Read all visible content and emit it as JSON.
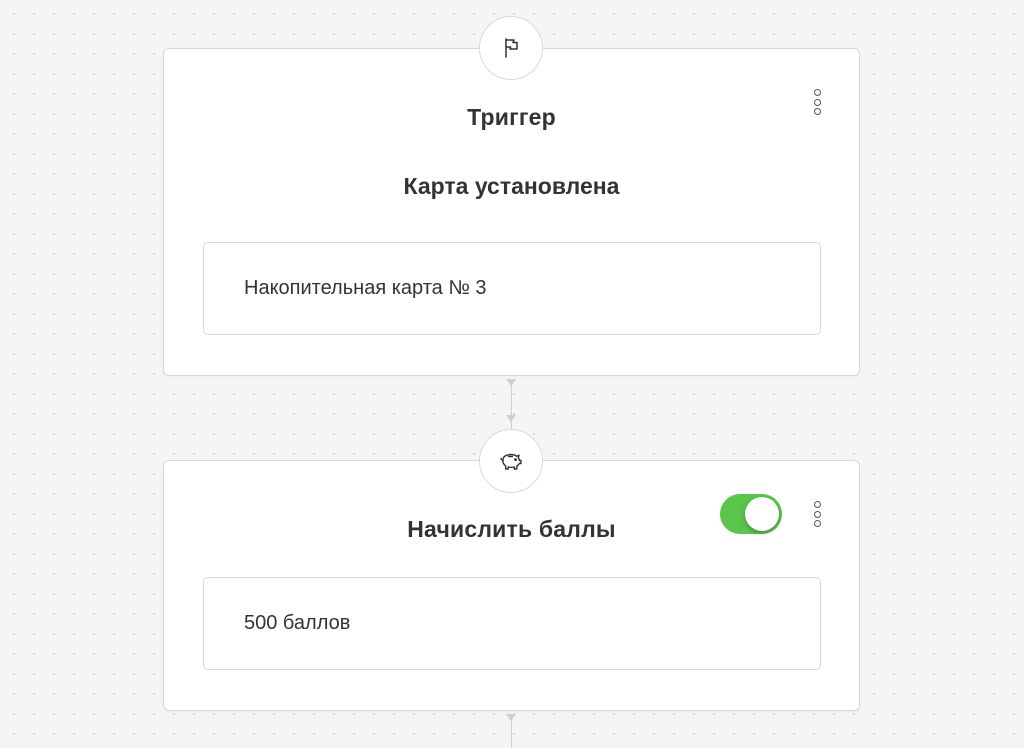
{
  "trigger_node": {
    "icon": "flag-icon",
    "title": "Триггер",
    "subtitle": "Карта установлена",
    "field_value": "Накопительная карта № 3",
    "menu_icon": "kebab-menu-icon"
  },
  "points_node": {
    "icon": "piggy-bank-icon",
    "title": "Начислить баллы",
    "field_value": "500 баллов",
    "enabled": true,
    "menu_icon": "kebab-menu-icon"
  },
  "colors": {
    "toggle_on": "#5ac54b",
    "card_border": "#d9d9d9",
    "canvas_bg": "#f5f5f5",
    "text": "#333333"
  }
}
